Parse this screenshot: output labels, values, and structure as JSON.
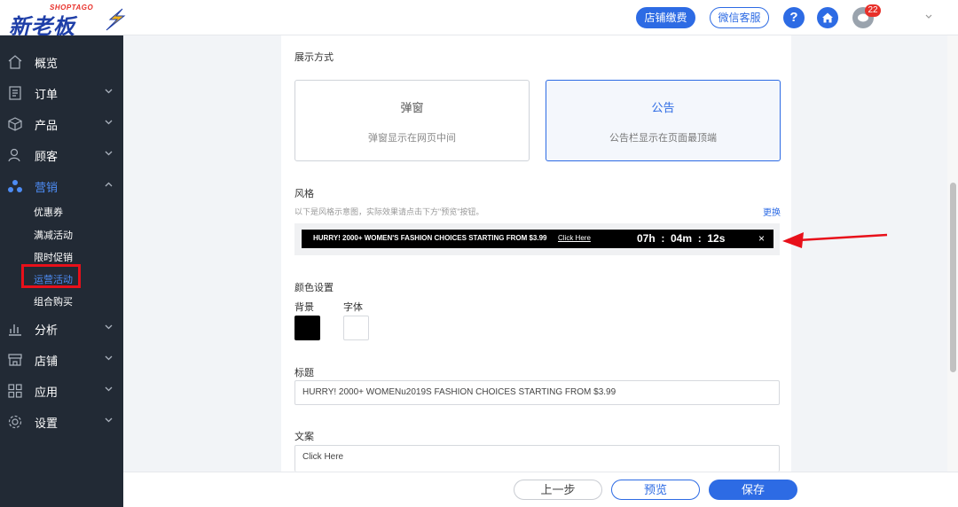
{
  "header": {
    "logo_small": "SHOPTAGO",
    "logo_big": "新老板",
    "fee_button": "店铺缴费",
    "wechat_button": "微信客服",
    "help_icon": "?",
    "notification_count": "22",
    "brand_color": "#2d6be4"
  },
  "sidebar": {
    "items": [
      {
        "label": "概览",
        "icon": "home-outline-icon"
      },
      {
        "label": "订单",
        "icon": "document-icon"
      },
      {
        "label": "产品",
        "icon": "box-icon"
      },
      {
        "label": "顾客",
        "icon": "user-icon"
      },
      {
        "label": "营销",
        "icon": "marketing-icon"
      },
      {
        "label": "分析",
        "icon": "bar-chart-icon"
      },
      {
        "label": "店铺",
        "icon": "store-icon"
      },
      {
        "label": "应用",
        "icon": "apps-icon"
      },
      {
        "label": "设置",
        "icon": "gear-icon"
      }
    ],
    "marketing_sub": [
      "优惠券",
      "满减活动",
      "限时促销",
      "运营活动",
      "组合购买"
    ]
  },
  "main": {
    "display_mode_label": "展示方式",
    "popup_title": "弹窗",
    "popup_desc": "弹窗显示在网页中间",
    "notice_title": "公告",
    "notice_desc": "公告栏显示在页面最顶端",
    "style_label": "风格",
    "style_hint": "以下是风格示意图，实际效果请点击下方\"预览\"按钮。",
    "change_link": "更换",
    "announcement": {
      "message": "HURRY! 2000+ WOMEN'S FASHION CHOICES STARTING FROM $3.99",
      "link": "Click Here",
      "timer": "07h  :  04m  :  12s",
      "close": "×"
    },
    "color_settings_label": "颜色设置",
    "bg_label": "背景",
    "font_label": "字体",
    "title_label": "标题",
    "title_value": "HURRY! 2000+ WOMENu2019S FASHION CHOICES STARTING FROM $3.99",
    "copy_label": "文案",
    "copy_value": "Click Here"
  },
  "footer": {
    "prev": "上一步",
    "preview": "预览",
    "save": "保存"
  }
}
